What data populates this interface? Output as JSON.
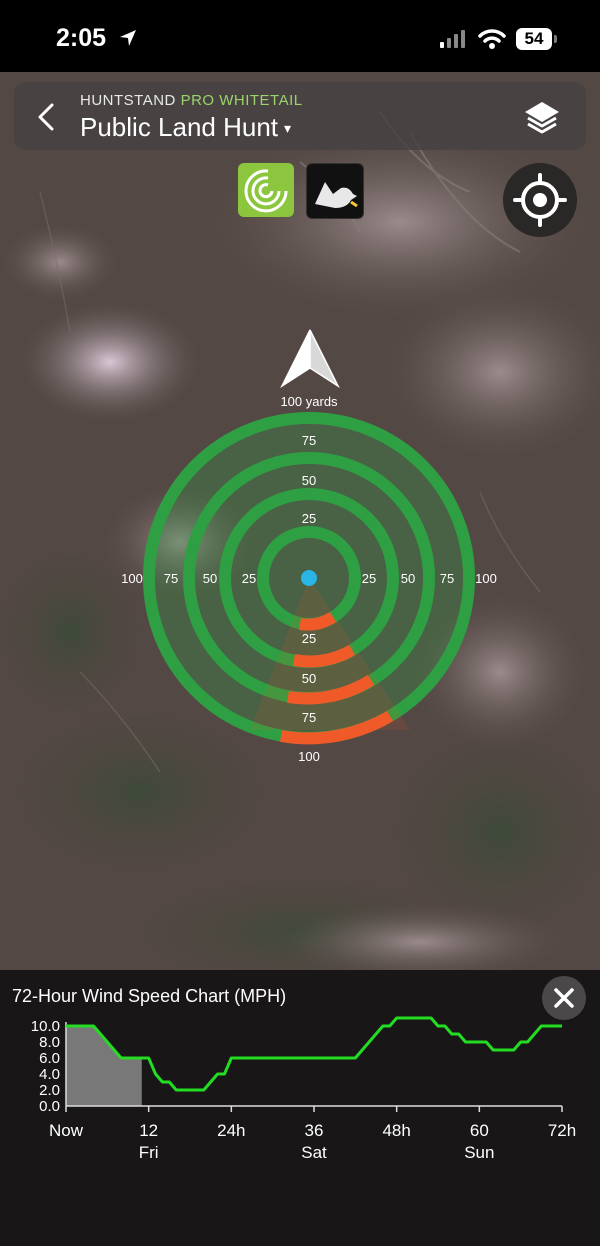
{
  "status_bar": {
    "time": "2:05",
    "battery": "54"
  },
  "header": {
    "brand": "HUNTSTAND",
    "brand_tier": "PRO WHITETAIL",
    "hunt_title": "Public Land Hunt",
    "caret": "▾"
  },
  "map": {
    "scale_label": "100 yards",
    "rings": {
      "top_labels": [
        "75",
        "50",
        "25"
      ],
      "left_labels": [
        "100",
        "75",
        "50",
        "25"
      ],
      "right_labels": [
        "25",
        "50",
        "75",
        "100"
      ],
      "bottom_labels": [
        "25",
        "50",
        "75",
        "100"
      ]
    },
    "colors": {
      "ring": "#2ea043",
      "wind_arc": "#f05a28",
      "center_dot": "#29b6e6"
    }
  },
  "chart_data": {
    "type": "line",
    "title": "72-Hour Wind Speed Chart (MPH)",
    "x_tick_labels": [
      "Now",
      "12",
      "24h",
      "36",
      "48h",
      "60",
      "72h"
    ],
    "x_day_labels": [
      {
        "at": 12,
        "label": "Fri"
      },
      {
        "at": 36,
        "label": "Sat"
      },
      {
        "at": 60,
        "label": "Sun"
      }
    ],
    "y_tick_labels": [
      "10.0",
      "8.0",
      "6.0",
      "4.0",
      "2.0",
      "0.0"
    ],
    "xlim": [
      0,
      72
    ],
    "ylim": [
      0,
      10
    ],
    "series": [
      {
        "color": "#22dd22",
        "x": [
          0,
          1,
          2,
          3,
          4,
          5,
          6,
          7,
          8,
          9,
          10,
          11,
          12,
          13,
          14,
          15,
          16,
          17,
          18,
          19,
          20,
          21,
          22,
          23,
          24,
          25,
          26,
          27,
          28,
          29,
          30,
          31,
          32,
          33,
          34,
          35,
          36,
          37,
          38,
          39,
          40,
          41,
          42,
          43,
          44,
          45,
          46,
          47,
          48,
          49,
          50,
          51,
          52,
          53,
          54,
          55,
          56,
          57,
          58,
          59,
          60,
          61,
          62,
          63,
          64,
          65,
          66,
          67,
          68,
          69,
          70,
          71,
          72
        ],
        "y": [
          10,
          10,
          10,
          10,
          10,
          9,
          8,
          7,
          6,
          6,
          6,
          6,
          6,
          4,
          3,
          3,
          2,
          2,
          2,
          2,
          2,
          3,
          4,
          4,
          6,
          6,
          6,
          6,
          6,
          6,
          6,
          6,
          6,
          6,
          6,
          6,
          6,
          6,
          6,
          6,
          6,
          6,
          6,
          7,
          8,
          9,
          10,
          10,
          11,
          11,
          11,
          11,
          11,
          11,
          10,
          10,
          9,
          9,
          8,
          8,
          8,
          8,
          7,
          7,
          7,
          7,
          8,
          8,
          9,
          10,
          10,
          10,
          10
        ]
      }
    ],
    "shaded_region": {
      "x_start": 0,
      "x_end": 11,
      "color": "#8a8a8a"
    },
    "grid": false,
    "legend": "none"
  }
}
